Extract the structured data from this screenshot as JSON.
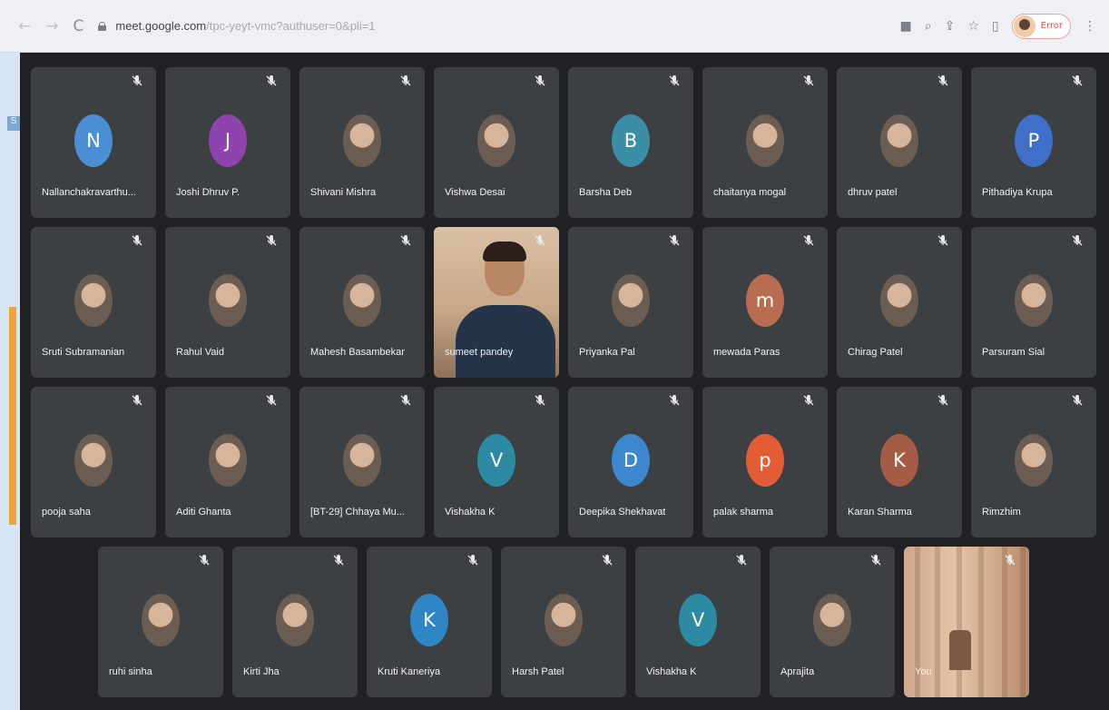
{
  "browser": {
    "url_host": "meet.google.com",
    "url_path": "/tpc-yeyt-vmc?authuser=0&pli=1",
    "profile_label": "Error"
  },
  "colors": {
    "tile_bg": "#3c4043",
    "stage_bg": "#202124",
    "muted_icon": "#e8eaed"
  },
  "participants": [
    {
      "name": "Nallanchakravarthu...",
      "initial": "N",
      "color": "#4a8fd3",
      "kind": "initial"
    },
    {
      "name": "Joshi Dhruv P.",
      "initial": "J",
      "color": "#8e44ad",
      "kind": "initial"
    },
    {
      "name": "Shivani Mishra",
      "kind": "photo"
    },
    {
      "name": "Vishwa Desai",
      "kind": "photo"
    },
    {
      "name": "Barsha Deb",
      "initial": "B",
      "color": "#3a8fa6",
      "kind": "initial"
    },
    {
      "name": "chaitanya mogal",
      "kind": "photo"
    },
    {
      "name": "dhruv patel",
      "kind": "photo"
    },
    {
      "name": "Pithadiya Krupa",
      "initial": "P",
      "color": "#3f6fc9",
      "kind": "initial"
    },
    {
      "name": "Sruti Subramanian",
      "kind": "photo"
    },
    {
      "name": "Rahul Vaid",
      "kind": "photo"
    },
    {
      "name": "Mahesh Basambekar",
      "kind": "photo"
    },
    {
      "name": "sumeet pandey",
      "kind": "video"
    },
    {
      "name": "Priyanka Pal",
      "kind": "photo"
    },
    {
      "name": "mewada Paras",
      "initial": "m",
      "color": "#b86c50",
      "kind": "initial"
    },
    {
      "name": "Chirag Patel",
      "kind": "photo"
    },
    {
      "name": "Parsuram Sial",
      "kind": "photo"
    },
    {
      "name": "pooja saha",
      "kind": "photo"
    },
    {
      "name": "Aditi Ghanta",
      "kind": "photo"
    },
    {
      "name": "[BT-29] Chhaya Mu...",
      "kind": "photo"
    },
    {
      "name": "Vishakha K",
      "initial": "V",
      "color": "#2d8aa3",
      "kind": "initial"
    },
    {
      "name": "Deepika Shekhavat",
      "initial": "D",
      "color": "#3d87cf",
      "kind": "initial"
    },
    {
      "name": "palak sharma",
      "initial": "p",
      "color": "#e35d34",
      "kind": "initial"
    },
    {
      "name": "Karan Sharma",
      "initial": "K",
      "color": "#a55c44",
      "kind": "initial"
    },
    {
      "name": "Rimzhim",
      "kind": "photo"
    },
    {
      "name": "ruhi sinha",
      "kind": "photo"
    },
    {
      "name": "Kirti Jha",
      "kind": "photo"
    },
    {
      "name": "Kruti Kaneriya",
      "initial": "K",
      "color": "#2f86c4",
      "kind": "initial"
    },
    {
      "name": "Harsh Patel",
      "kind": "photo"
    },
    {
      "name": "Vishakha K",
      "initial": "V",
      "color": "#2d8aa3",
      "kind": "initial"
    },
    {
      "name": "Aprajita",
      "kind": "photo"
    },
    {
      "name": "You",
      "kind": "you"
    }
  ]
}
